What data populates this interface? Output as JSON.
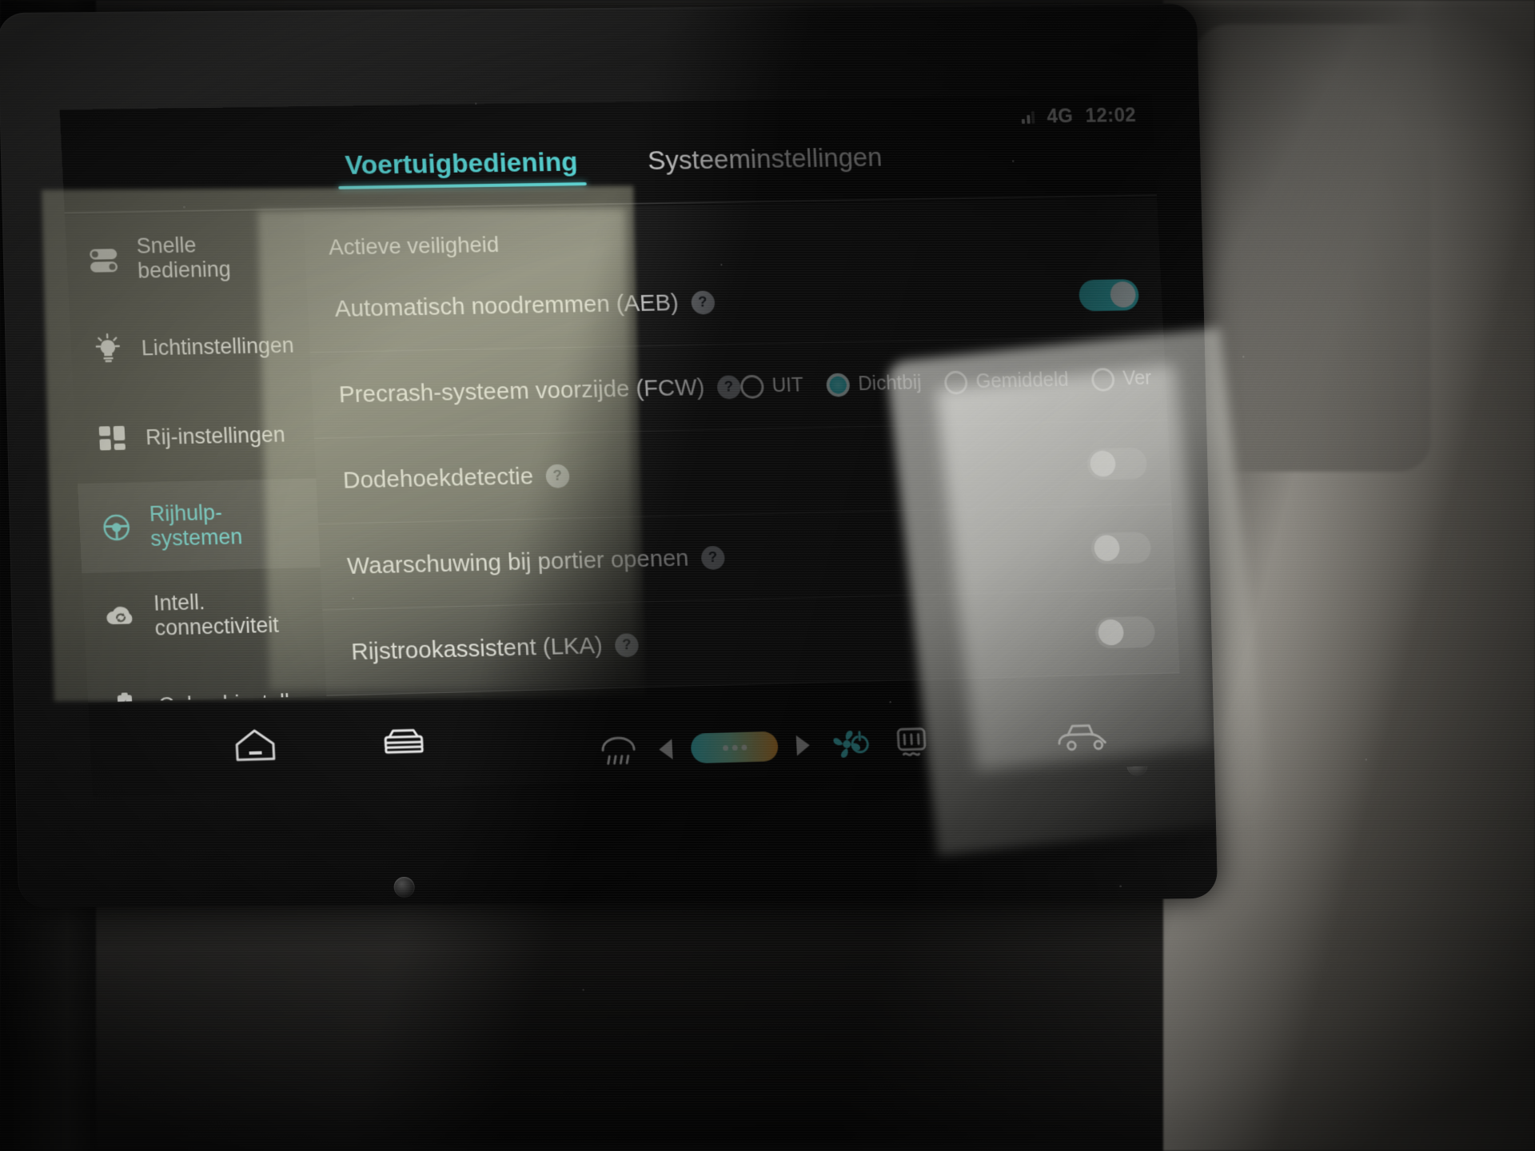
{
  "status_bar": {
    "network": "4G",
    "time": "12:02",
    "signal_icon": "signal-bars-icon"
  },
  "tabs": [
    {
      "label": "Voertuigbediening",
      "active": true
    },
    {
      "label": "Systeeminstellingen",
      "active": false
    }
  ],
  "sidebar": {
    "items": [
      {
        "label": "Snelle bediening",
        "icon": "sliders-icon",
        "active": false
      },
      {
        "label": "Lichtinstellingen",
        "icon": "lightbulb-icon",
        "active": false
      },
      {
        "label": "Rij-instellingen",
        "icon": "grid-squares-icon",
        "active": false
      },
      {
        "label": "Rijhulp-systemen",
        "icon": "steering-wheel-icon",
        "active": true
      },
      {
        "label": "Intell. connectiviteit",
        "icon": "cloud-sync-icon",
        "active": false
      },
      {
        "label": "Oplaad-instell.",
        "icon": "battery-charge-icon",
        "active": false
      }
    ]
  },
  "content": {
    "section_title": "Actieve veiligheid",
    "help_glyph": "?",
    "rows": [
      {
        "label": "Automatisch noodremmen (AEB)",
        "control": "toggle",
        "toggle_on": true
      },
      {
        "label": "Precrash-systeem voorzijde (FCW)",
        "control": "radio",
        "options": [
          {
            "label": "UIT",
            "selected": false
          },
          {
            "label": "Dichtbij",
            "selected": true
          },
          {
            "label": "Gemiddeld",
            "selected": false
          },
          {
            "label": "Ver",
            "selected": false
          }
        ]
      },
      {
        "label": "Dodehoekdetectie",
        "control": "toggle",
        "toggle_on": false
      },
      {
        "label": "Waarschuwing bij portier openen",
        "control": "toggle",
        "toggle_on": false
      },
      {
        "label": "Rijstrookassistent (LKA)",
        "control": "toggle",
        "toggle_on": false
      }
    ]
  },
  "bottom_bar": {
    "items": [
      {
        "icon": "home-icon",
        "name": "home-button"
      },
      {
        "icon": "car-icon",
        "name": "vehicle-button"
      },
      {
        "icon": "rear-defrost-icon",
        "name": "rear-defrost-button"
      },
      {
        "icon": "front-defrost-icon",
        "name": "front-defrost-button"
      },
      {
        "icon": "car-seat-icon",
        "name": "seat-button"
      }
    ],
    "climate": {
      "decrease_icon": "arrow-left-icon",
      "increase_icon": "arrow-right-icon",
      "fan_icon": "fan-icon",
      "power_icon": "power-icon"
    }
  },
  "colors": {
    "accent": "#5fe8e8",
    "toggle_on": "#3ecfd6",
    "text": "#f2f2f2",
    "panel": "#202020"
  }
}
